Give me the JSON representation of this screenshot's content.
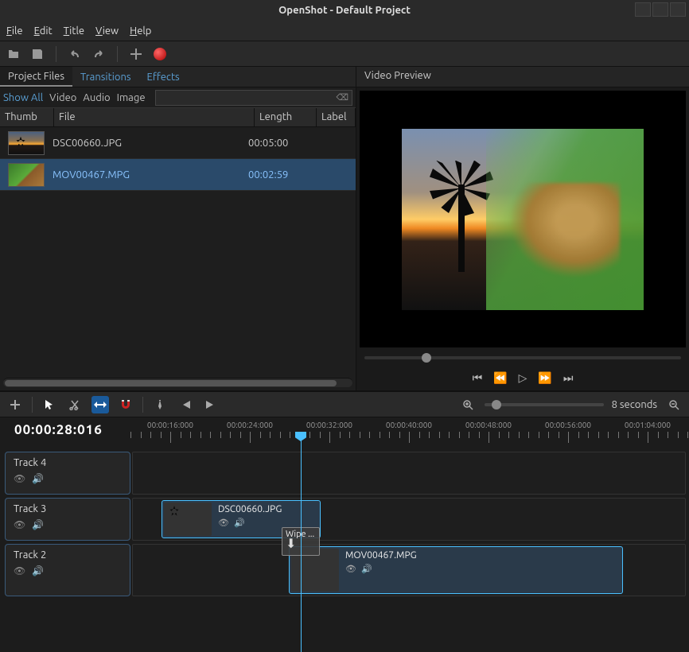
{
  "window": {
    "title": "OpenShot - Default Project"
  },
  "menu": [
    "File",
    "Edit",
    "Title",
    "View",
    "Help"
  ],
  "panel": {
    "tabs": [
      "Project Files",
      "Transitions",
      "Effects"
    ],
    "filters": [
      "Show All",
      "Video",
      "Audio",
      "Image"
    ],
    "columns": {
      "thumb": "Thumb",
      "file": "File",
      "length": "Length",
      "label": "Label"
    },
    "files": [
      {
        "name": "DSC00660.JPG",
        "length": "00:05:00"
      },
      {
        "name": "MOV00467.MPG",
        "length": "00:02:59"
      }
    ]
  },
  "preview": {
    "title": "Video Preview"
  },
  "timeline_toolbar": {
    "zoom_label": "8 seconds"
  },
  "timeline": {
    "timecode": "00:00:28:016",
    "ruler": [
      "00:00:16:000",
      "00:00:24:000",
      "00:00:32:000",
      "00:00:40:000",
      "00:00:48:000",
      "00:00:56:000",
      "00:01:04:000"
    ],
    "tracks": [
      {
        "name": "Track 4"
      },
      {
        "name": "Track 3"
      },
      {
        "name": "Track 2"
      }
    ],
    "clips": {
      "c1": "DSC00660.JPG",
      "c2": "MOV00467.MPG",
      "transition": "Wipe ..."
    }
  }
}
